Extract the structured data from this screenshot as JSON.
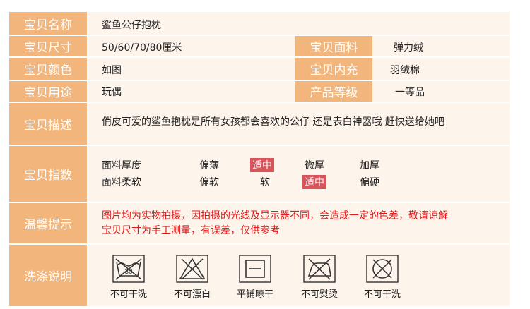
{
  "rows": {
    "name": {
      "label": "宝贝名称",
      "value": "鲨鱼公仔抱枕"
    },
    "size": {
      "label": "宝贝尺寸",
      "value": "50/60/70/80厘米",
      "label2": "宝贝面料",
      "value2": "弹力绒"
    },
    "color": {
      "label": "宝贝颜色",
      "value": "如图",
      "label2": "宝贝内充",
      "value2": "羽绒棉"
    },
    "use": {
      "label": "宝贝用途",
      "value": "玩偶",
      "label2": "产品等级",
      "value2": "一等品"
    },
    "desc": {
      "label": "宝贝描述",
      "value": "俏皮可爱的鲨鱼抱枕是所有女孩都会喜欢的公仔 还是表白神器哦  赶快送给她吧"
    },
    "index": {
      "label": "宝贝指数",
      "rows": [
        {
          "name": "面料厚度",
          "options": [
            "偏薄",
            "适中",
            "微厚",
            "加厚"
          ],
          "selected": 1
        },
        {
          "name": "面料柔软",
          "options": [
            "偏软",
            "软",
            "适中",
            "偏硬"
          ],
          "selected": 2
        }
      ]
    },
    "tips": {
      "label": "温馨提示",
      "line1": "图片均为实物拍摄，因拍摄的光线及显示器不同，会造成一定的色差，敬请谅解",
      "line2": "宝贝尺寸为手工测量，有误差，仅供参考"
    },
    "wash": {
      "label": "洗涤说明",
      "items": [
        {
          "icon": "no-wash-icon",
          "text": "不可干洗",
          "number": "30"
        },
        {
          "icon": "no-bleach-icon",
          "text": "不可漂白"
        },
        {
          "icon": "flat-dry-icon",
          "text": "平铺晾干"
        },
        {
          "icon": "no-iron-icon",
          "text": "不可熨烫"
        },
        {
          "icon": "no-dryclean-icon",
          "text": "不可干洗"
        }
      ]
    }
  },
  "colors": {
    "label_bg": "#f2b67d",
    "cell_bg": "#fdf4ec",
    "highlight": "#d8535a",
    "tip_text": "#e21a1a"
  }
}
